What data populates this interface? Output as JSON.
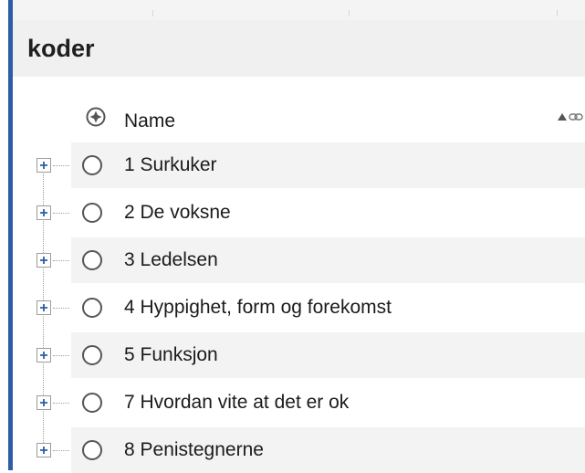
{
  "panel": {
    "title": "koder"
  },
  "columns": {
    "name_label": "Name",
    "status_icon": "target-icon",
    "sort_icon": "sort-ascending-icon",
    "link_icon": "link-icon"
  },
  "rows": [
    {
      "label": "1 Surkuker"
    },
    {
      "label": "2 De voksne"
    },
    {
      "label": "3 Ledelsen"
    },
    {
      "label": "4 Hyppighet, form og forekomst"
    },
    {
      "label": "5 Funksjon"
    },
    {
      "label": "7 Hvordan vite at det er ok"
    },
    {
      "label": "8 Penistegnerne"
    }
  ],
  "colors": {
    "accent": "#2b5ea7",
    "header_bg": "#f0f0f0",
    "alt_row_bg": "#f3f3f3"
  }
}
